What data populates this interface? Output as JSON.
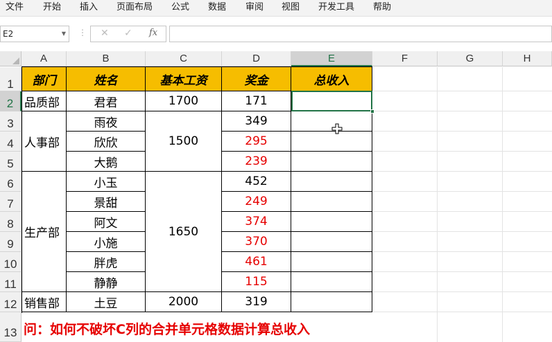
{
  "ribbon": {
    "tabs": [
      "文件",
      "开始",
      "插入",
      "页面布局",
      "公式",
      "数据",
      "审阅",
      "视图",
      "开发工具",
      "帮助"
    ]
  },
  "formula_bar": {
    "name_box": "E2",
    "fx_label": "fx",
    "cancel_glyph": "✕",
    "enter_glyph": "✓",
    "separator": "⋮",
    "value": ""
  },
  "columns": [
    "A",
    "B",
    "C",
    "D",
    "E",
    "F",
    "G",
    "H"
  ],
  "rows": [
    "1",
    "2",
    "3",
    "4",
    "5",
    "6",
    "7",
    "8",
    "9",
    "10",
    "11",
    "12",
    "13"
  ],
  "table": {
    "headers": [
      "部门",
      "姓名",
      "基本工资",
      "奖金",
      "总收入"
    ],
    "departments": [
      "品质部",
      "人事部",
      "生产部",
      "销售部"
    ],
    "names": [
      "君君",
      "雨夜",
      "欣欣",
      "大鹅",
      "小玉",
      "景甜",
      "阿文",
      "小施",
      "胖虎",
      "静静",
      "土豆"
    ],
    "base_salaries": [
      "1700",
      "1500",
      "1650",
      "2000"
    ],
    "bonuses": [
      "171",
      "349",
      "295",
      "239",
      "452",
      "249",
      "374",
      "370",
      "461",
      "115",
      "319"
    ]
  },
  "question": "问：如何不破坏C列的合并单元格数据计算总收入",
  "colors": {
    "header_fill": "#f6bd00",
    "red_text": "#e60000",
    "selection": "#217346"
  }
}
